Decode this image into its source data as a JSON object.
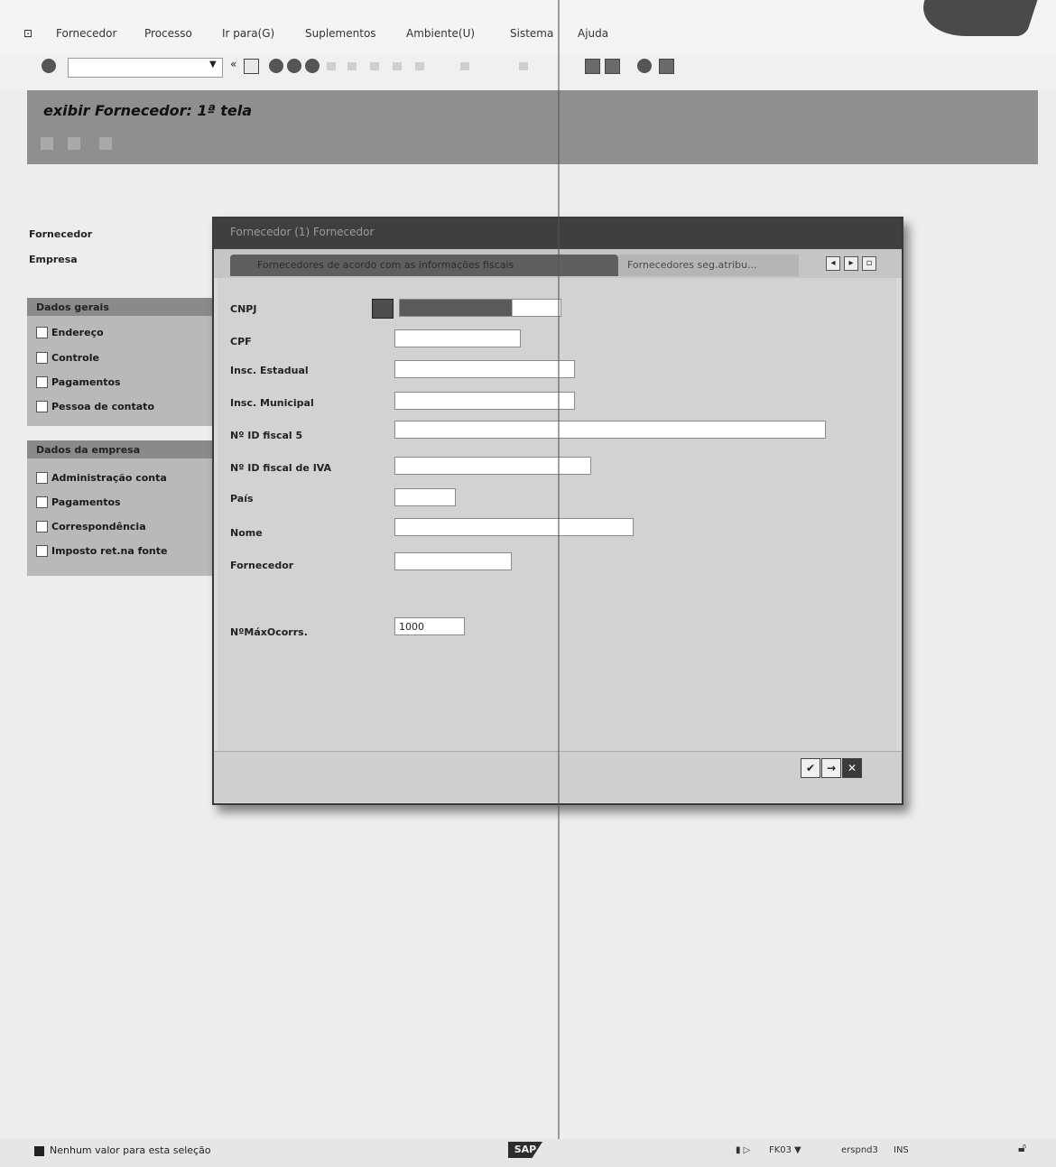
{
  "menu": {
    "items": [
      "Fornecedor",
      "Processo",
      "Ir para(G)",
      "Suplementos",
      "Ambiente(U)",
      "Sistema",
      "Ajuda"
    ]
  },
  "screen": {
    "title": "exibir Fornecedor: 1ª tela"
  },
  "left_panel": {
    "fornecedor_label": "Fornecedor",
    "empresa_label": "Empresa",
    "dados_gerais": {
      "title": "Dados gerais",
      "items": [
        "Endereço",
        "Controle",
        "Pagamentos",
        "Pessoa de contato"
      ]
    },
    "dados_empresa": {
      "title": "Dados da empresa",
      "items": [
        "Administração conta",
        "Pagamentos",
        "Correspondência",
        "Imposto ret.na fonte"
      ]
    }
  },
  "dialog": {
    "title": "Fornecedor (1) Fornecedor",
    "tabs": [
      {
        "label": "Fornecedores de acordo com as informações fiscais"
      },
      {
        "label": "Fornecedores seg.atribu..."
      }
    ],
    "fields": {
      "cnpj": {
        "label": "CNPJ",
        "value": ""
      },
      "cpf": {
        "label": "CPF",
        "value": ""
      },
      "insc_estadual": {
        "label": "Insc. Estadual",
        "value": ""
      },
      "insc_municipal": {
        "label": "Insc. Municipal",
        "value": ""
      },
      "id_fiscal_5": {
        "label": "Nº ID fiscal 5",
        "value": ""
      },
      "id_fiscal_iva": {
        "label": "Nº ID fiscal de IVA",
        "value": ""
      },
      "pais": {
        "label": "País",
        "value": ""
      },
      "nome": {
        "label": "Nome",
        "value": ""
      },
      "fornecedor": {
        "label": "Fornecedor",
        "value": ""
      },
      "max_ocorrs": {
        "label": "NºMáxOcorrs.",
        "value": "1000"
      }
    }
  },
  "status": {
    "message": "Nenhum valor para esta seleção",
    "sap_logo": "SAP",
    "transaction": "FK03",
    "server": "erspnd3",
    "client": "INS"
  }
}
